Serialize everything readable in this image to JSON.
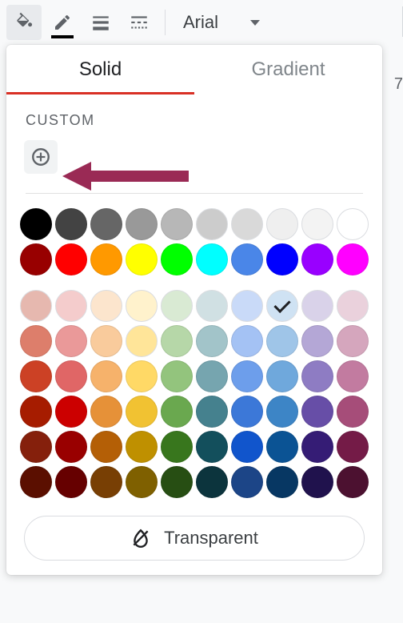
{
  "toolbar": {
    "font": "Arial"
  },
  "tabs": {
    "solid": "Solid",
    "gradient": "Gradient"
  },
  "custom": {
    "label": "CUSTOM"
  },
  "transparent_label": "Transparent",
  "page_number": "7",
  "selected_index": 27,
  "colors_row1": [
    "#000000",
    "#434343",
    "#666666",
    "#999999",
    "#b7b7b7",
    "#cccccc",
    "#d9d9d9",
    "#efefef",
    "#f3f3f3",
    "#ffffff"
  ],
  "colors_row2": [
    "#980000",
    "#ff0000",
    "#ff9900",
    "#ffff00",
    "#00ff00",
    "#00ffff",
    "#4a86e8",
    "#0000ff",
    "#9900ff",
    "#ff00ff"
  ],
  "colors_body": [
    [
      "#e6b8af",
      "#f4cccc",
      "#fce5cd",
      "#fff2cc",
      "#d9ead3",
      "#d0e0e3",
      "#c9daf8",
      "#cfe2f3",
      "#d9d2e9",
      "#ead1dc"
    ],
    [
      "#dd7e6b",
      "#ea9999",
      "#f9cb9c",
      "#ffe599",
      "#b6d7a8",
      "#a2c4c9",
      "#a4c2f4",
      "#9fc5e8",
      "#b4a7d6",
      "#d5a6bd"
    ],
    [
      "#cc4125",
      "#e06666",
      "#f6b26b",
      "#ffd966",
      "#93c47d",
      "#76a5af",
      "#6d9eeb",
      "#6fa8dc",
      "#8e7cc3",
      "#c27ba0"
    ],
    [
      "#a61c00",
      "#cc0000",
      "#e69138",
      "#f1c232",
      "#6aa84f",
      "#45818e",
      "#3c78d8",
      "#3d85c6",
      "#674ea7",
      "#a64d79"
    ],
    [
      "#85200c",
      "#990000",
      "#b45f06",
      "#bf9000",
      "#38761d",
      "#134f5c",
      "#1155cc",
      "#0b5394",
      "#351c75",
      "#741b47"
    ],
    [
      "#5b0f00",
      "#660000",
      "#783f04",
      "#7f6000",
      "#274e13",
      "#0c343d",
      "#1c4587",
      "#073763",
      "#20124d",
      "#4c1130"
    ]
  ]
}
